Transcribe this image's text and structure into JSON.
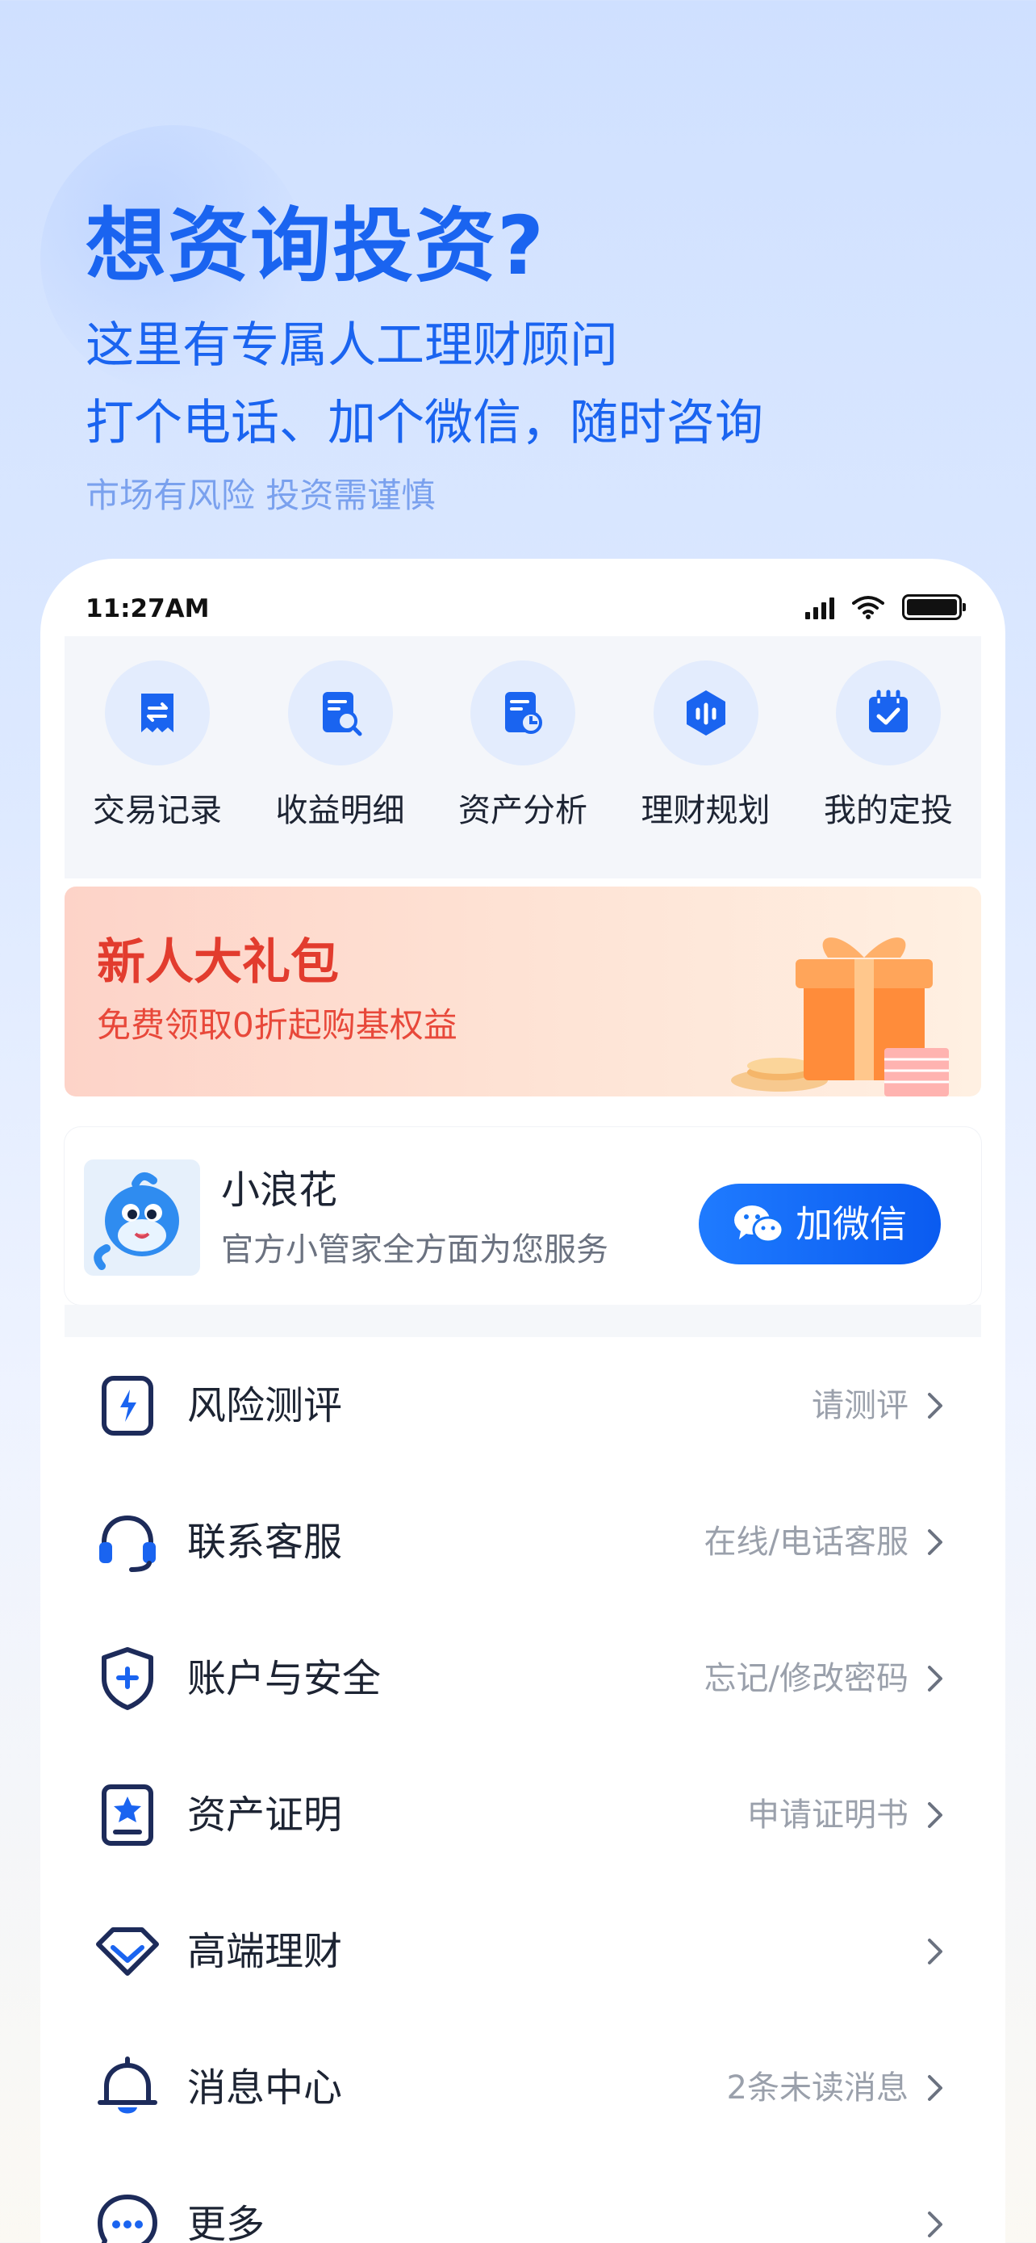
{
  "hero": {
    "title": "想资询投资?",
    "subtitle_line1": "这里有专属人工理财顾问",
    "subtitle_line2": "打个电话、加个微信，随时咨询",
    "risk_notice": "市场有风险 投资需谨慎"
  },
  "status_bar": {
    "time": "11:27AM"
  },
  "quick_actions": [
    {
      "label": "交易记录",
      "icon": "receipt-icon"
    },
    {
      "label": "收益明细",
      "icon": "document-search-icon"
    },
    {
      "label": "资产分析",
      "icon": "document-chart-icon"
    },
    {
      "label": "理财规划",
      "icon": "voice-bars-icon"
    },
    {
      "label": "我的定投",
      "icon": "calendar-check-icon"
    }
  ],
  "banner": {
    "title": "新人大礼包",
    "subtitle": "免费领取0折起购基权益"
  },
  "assistant": {
    "name": "小浪花",
    "description": "官方小管家全方面为您服务",
    "button_label": "加微信"
  },
  "menu": [
    {
      "label": "风险测评",
      "hint": "请测评",
      "icon": "lightning-icon"
    },
    {
      "label": "联系客服",
      "hint": "在线/电话客服",
      "icon": "headset-icon"
    },
    {
      "label": "账户与安全",
      "hint": "忘记/修改密码",
      "icon": "shield-plus-icon"
    },
    {
      "label": "资产证明",
      "hint": "申请证明书",
      "icon": "certificate-icon"
    },
    {
      "label": "高端理财",
      "hint": "",
      "icon": "diamond-icon"
    },
    {
      "label": "消息中心",
      "hint": "2条未读消息",
      "icon": "bell-icon"
    },
    {
      "label": "更多",
      "hint": "",
      "icon": "more-icon"
    }
  ],
  "colors": {
    "accent": "#1a64f0",
    "banner_red": "#e23c2e",
    "icon_navy": "#1d2b5a"
  }
}
